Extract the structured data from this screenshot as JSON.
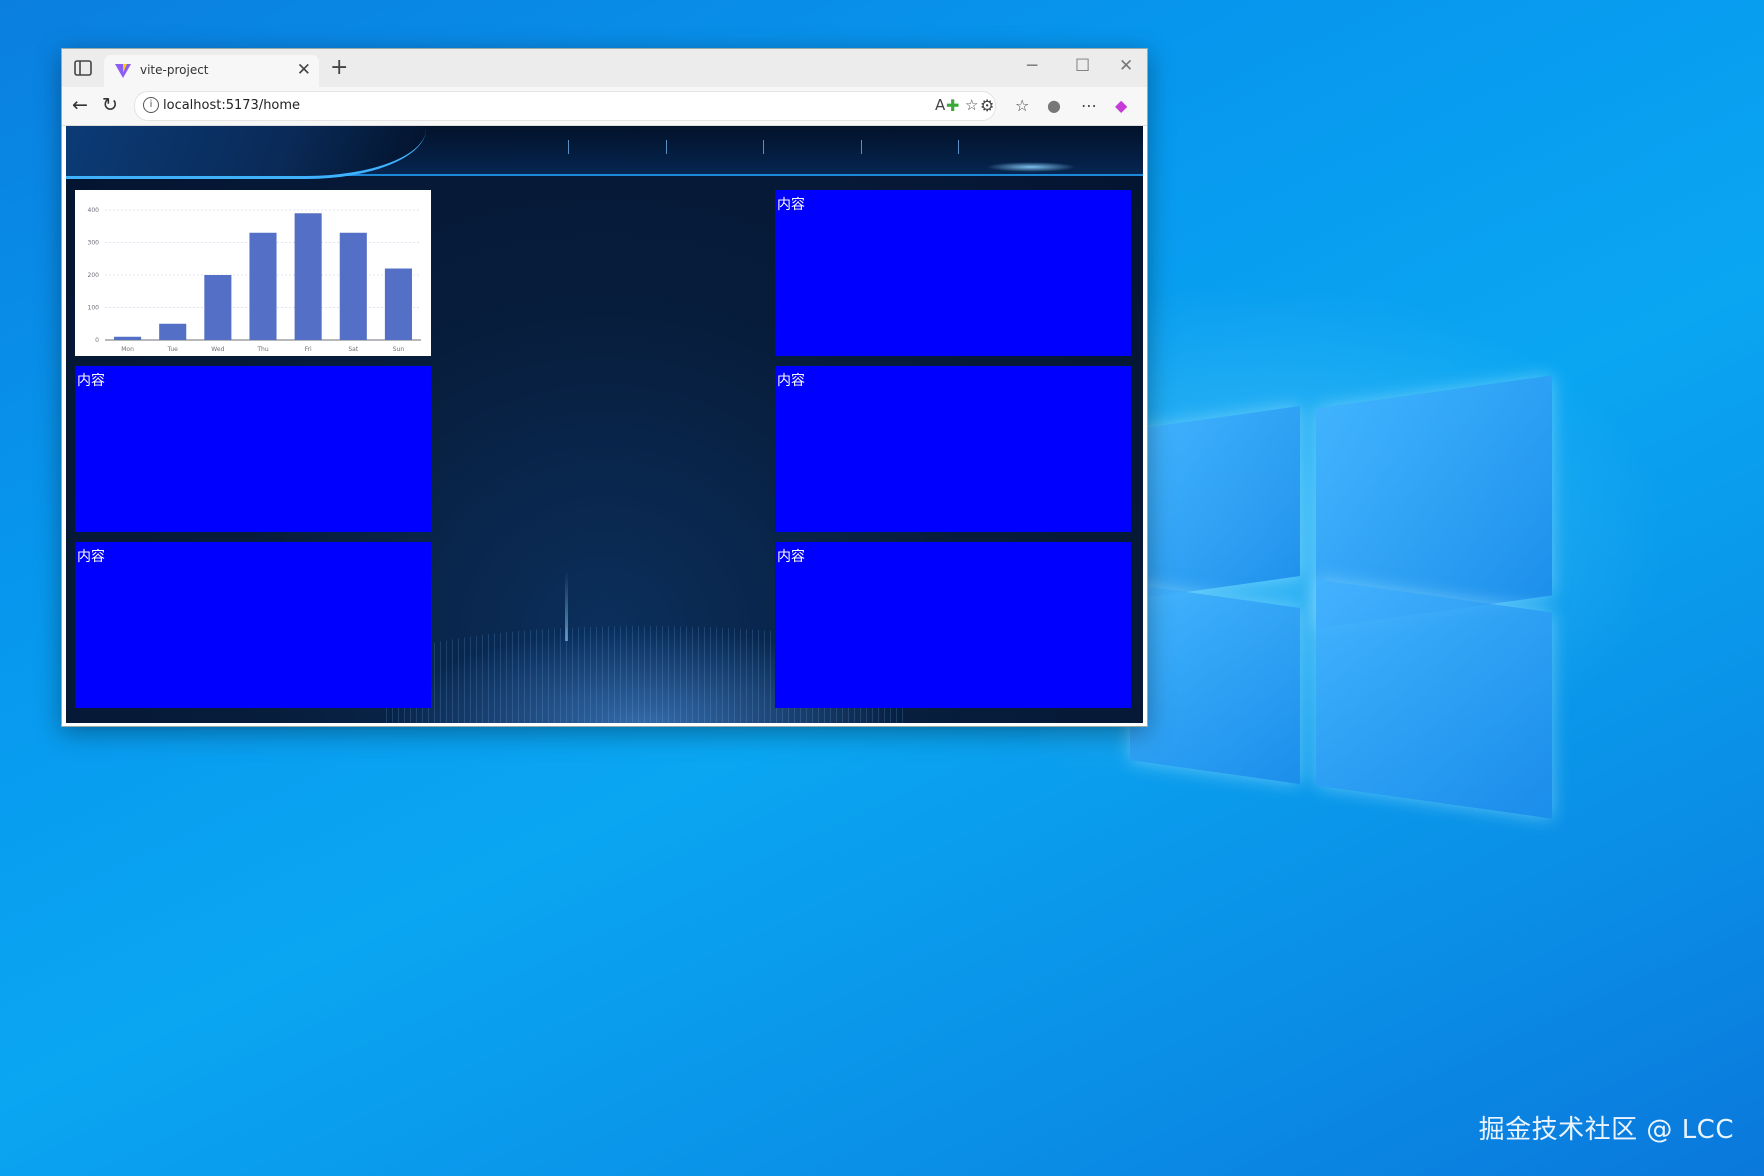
{
  "browser": {
    "tab_title": "vite-project",
    "url": "localhost:5173/home",
    "new_tab_symbol": "+",
    "close_symbol": "✕",
    "min_symbol": "─",
    "max_symbol": "☐",
    "winclose_symbol": "✕"
  },
  "panels": {
    "left_1": "内容",
    "left_2": "内容",
    "right_0": "内容",
    "right_1": "内容",
    "right_2": "内容"
  },
  "chart_data": {
    "type": "bar",
    "categories": [
      "Mon",
      "Tue",
      "Wed",
      "Thu",
      "Fri",
      "Sat",
      "Sun"
    ],
    "values": [
      10,
      50,
      200,
      330,
      390,
      330,
      220
    ],
    "ylim": [
      0,
      400
    ],
    "yticks": [
      0,
      100,
      200,
      300,
      400
    ],
    "bar_color": "#5470c6",
    "grid": true
  },
  "watermark": "掘金技术社区 @ LCC",
  "colors": {
    "panel_blue": "#0000ff",
    "desktop": "#0797ee"
  }
}
